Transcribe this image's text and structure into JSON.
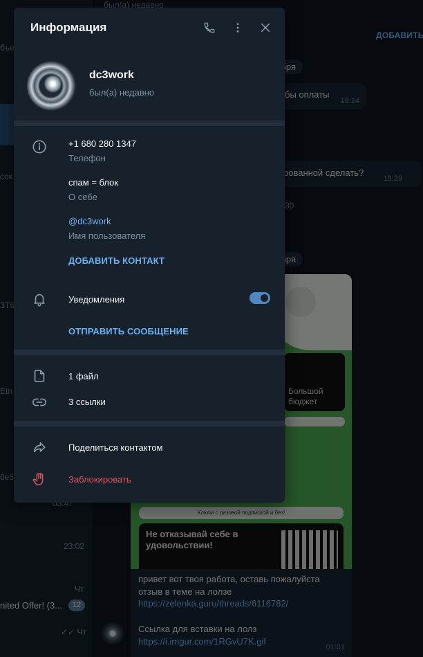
{
  "panel": {
    "title": "Информация",
    "name": "dc3work",
    "status": "был(а) недавно",
    "phone": "+1 680 280 1347",
    "phone_label": "Телефон",
    "bio": "спам = блок",
    "bio_label": "О себе",
    "username": "@dc3work",
    "username_label": "Имя пользователя",
    "add_contact": "ДОБАВИТЬ КОНТАКТ",
    "notifications": "Уведомления",
    "notifications_on": true,
    "send_message": "ОТПРАВИТЬ СООБЩЕНИЕ",
    "files": "1 файл",
    "links": "3 ссылки",
    "share_contact": "Поделиться контактом",
    "block": "Заблокировать"
  },
  "icons": {
    "call": "phone-icon",
    "menu": "more-vertical-icon",
    "close": "close-icon",
    "info": "info-icon",
    "bell": "bell-icon",
    "file": "file-icon",
    "link": "link-icon",
    "share": "share-icon",
    "block": "hand-icon"
  },
  "colors": {
    "panel_bg": "#17212b",
    "accent": "#6ab2f2",
    "danger": "#e0505e",
    "toggle": "#5288c1"
  },
  "background": {
    "top_status": "был(а) недавно",
    "add_button": "ДОБАВИТЬ",
    "date_1": "бря",
    "date_2": "бря",
    "msg_1": "бы оплаты",
    "msg_1_time": "18:24",
    "msg_2": "рованной сделать?",
    "msg_2_time": "18:29",
    "time_30": "30",
    "left_fragments": [
      "бъе",
      "сок",
      "ЗТ6",
      "Eth",
      "0e5",
      "03:47",
      "23:02",
      "Чт",
      "nited Offer! (3...",
      "Чт"
    ],
    "unread_count": "12",
    "image_card_text": "Большой бюджет",
    "image_bar_text": "Ключи с разовой подпиской и без!",
    "image_card2_text": "Не отказывай себе в удовольствии!",
    "caption_text": "привет вот твоя работа, оставь пожалуйста отзыв в теме на лолзе",
    "caption_link": "https://zelenka.guru/threads/6116782/",
    "last_msg": "Ссылка для вставки на лолз",
    "last_link": "https://i.imgur.com/1RGvU7K.gif",
    "last_time": "01:01"
  }
}
